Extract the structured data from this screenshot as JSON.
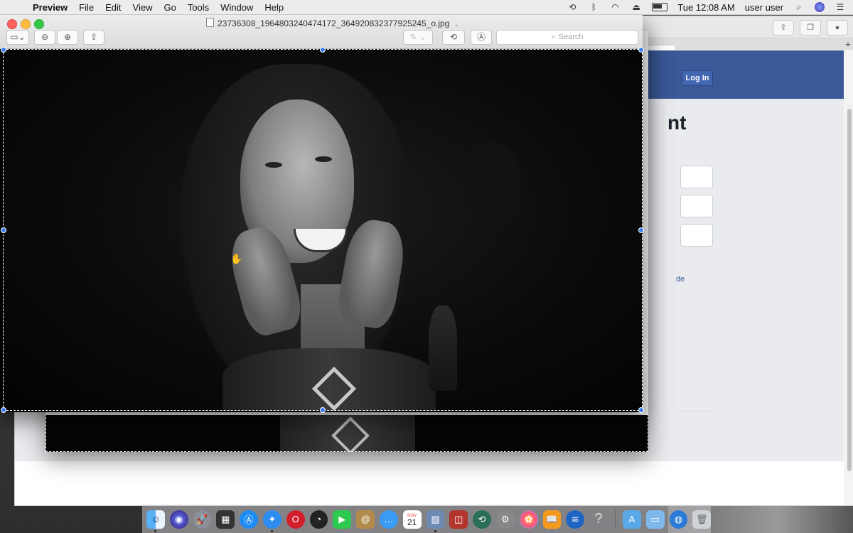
{
  "menubar": {
    "app_name": "Preview",
    "menus": [
      "File",
      "Edit",
      "View",
      "Go",
      "Tools",
      "Window",
      "Help"
    ],
    "clock": "Tue 12:08 AM",
    "user": "user user"
  },
  "preview": {
    "title": "23736308_1964803240474172_364920832377925245_o.jpg",
    "search_placeholder": "Search"
  },
  "browser": {
    "login_label": "Log In",
    "heading_fragment": "nt",
    "link_fragment": "de"
  },
  "dock": {
    "calendar_month": "NOV",
    "calendar_day": "21"
  }
}
